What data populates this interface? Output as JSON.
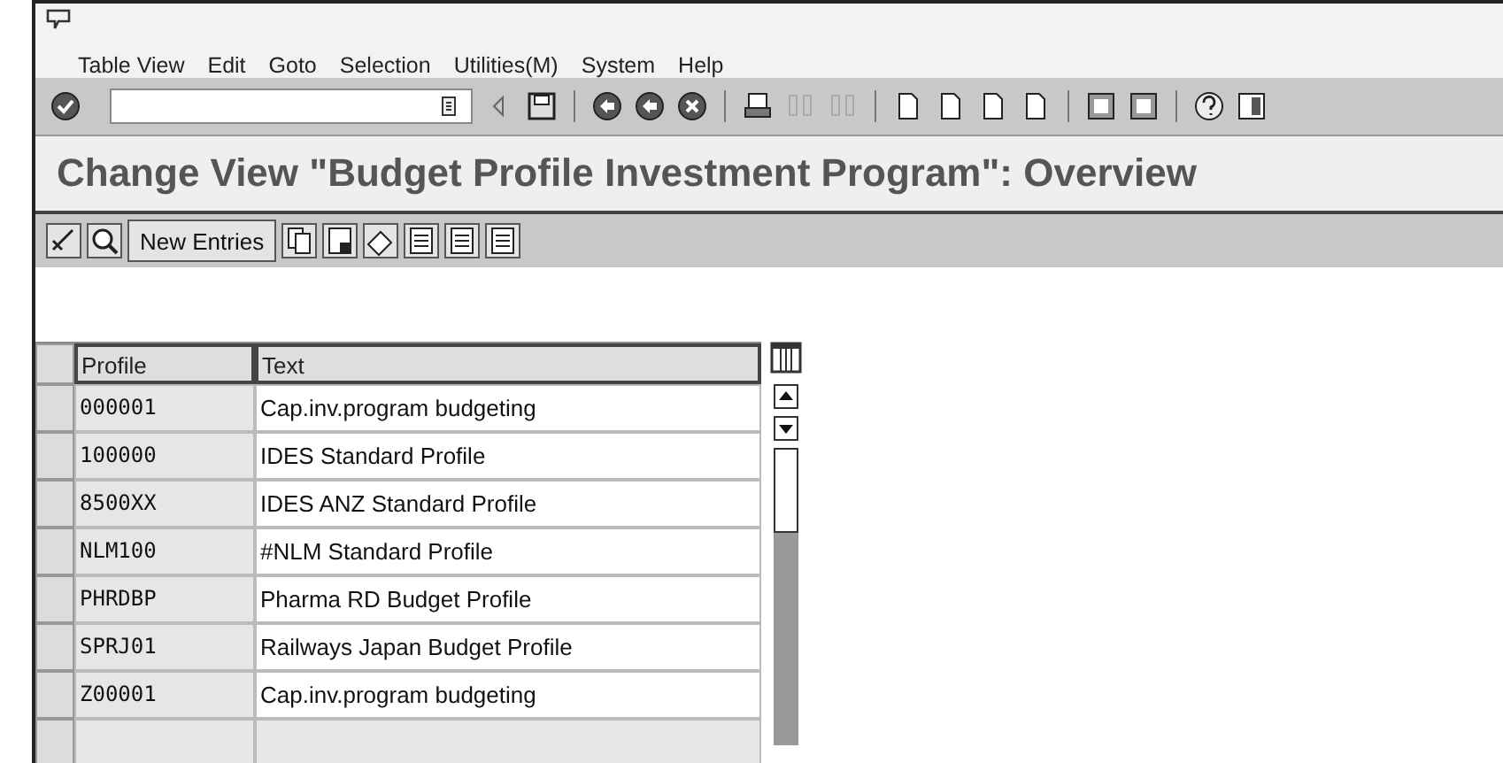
{
  "menu_bar": [
    {
      "label": "Table View"
    },
    {
      "label": "Edit"
    },
    {
      "label": "Goto"
    },
    {
      "label": "Selection"
    },
    {
      "label": "Utilities(M)"
    },
    {
      "label": "System"
    },
    {
      "label": "Help"
    }
  ],
  "title": "Change View \"Budget Profile Investment Program\": Overview",
  "app_toolbar": {
    "new_entries_button": "New Entries"
  },
  "table": {
    "columns": [
      "Profile",
      "Text"
    ],
    "rows": [
      {
        "profile": "000001",
        "text": "Cap.inv.program budgeting"
      },
      {
        "profile": "100000",
        "text": "IDES Standard Profile"
      },
      {
        "profile": "8500XX",
        "text": "IDES ANZ Standard Profile"
      },
      {
        "profile": "NLM100",
        "text": "#NLM Standard Profile"
      },
      {
        "profile": "PHRDBP",
        "text": "Pharma RD Budget Profile"
      },
      {
        "profile": "SPRJ01",
        "text": "Railways Japan Budget Profile"
      },
      {
        "profile": "Z00001",
        "text": "Cap.inv.program budgeting"
      }
    ]
  }
}
